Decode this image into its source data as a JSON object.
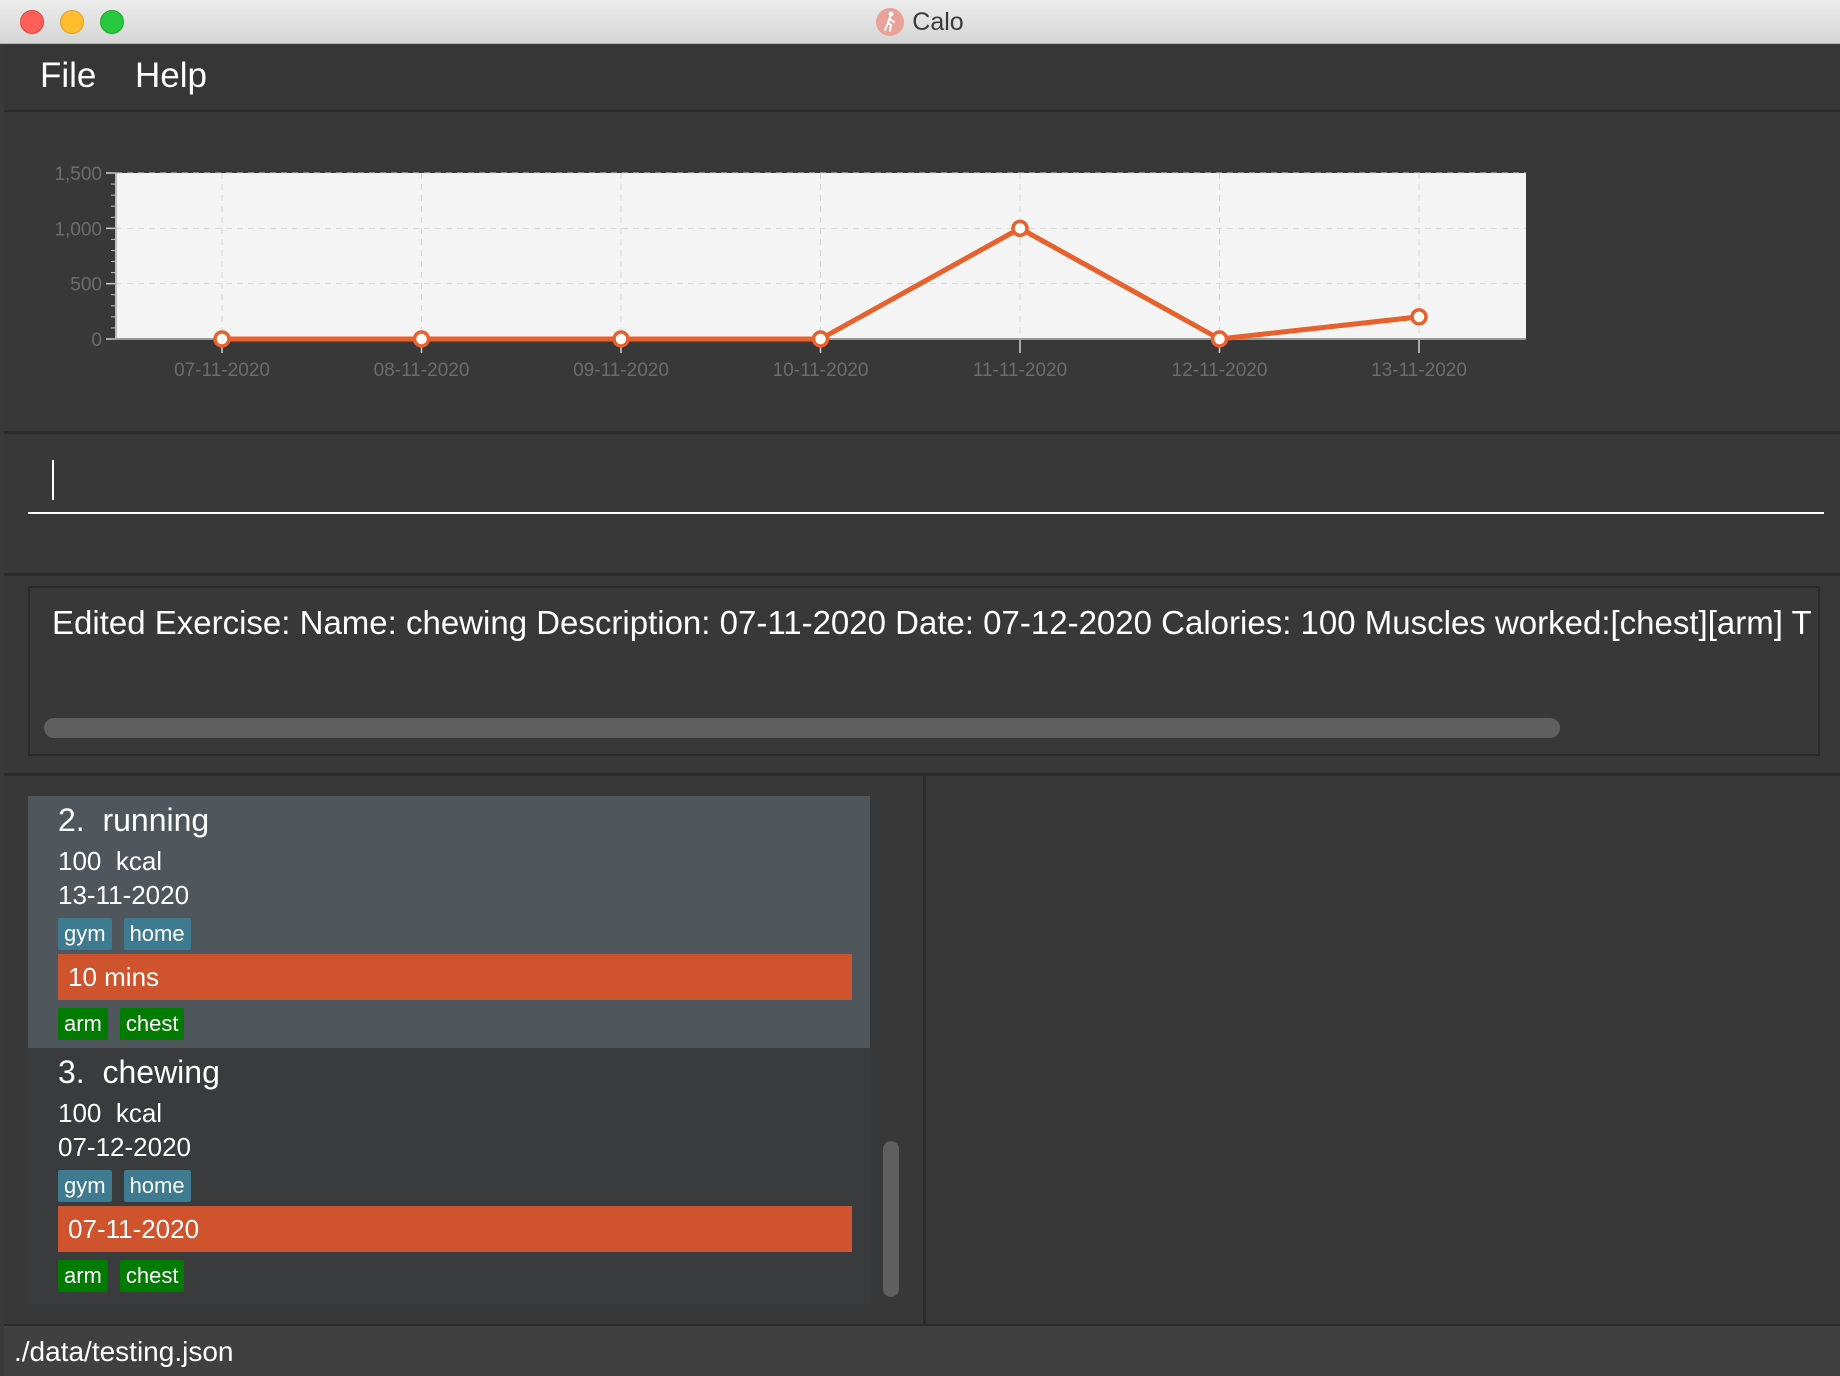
{
  "window": {
    "title": "Calo",
    "buttons": [
      "close",
      "minimize",
      "maximize"
    ],
    "app_icon": "walking-figure-icon"
  },
  "menu": {
    "items": [
      "File",
      "Help"
    ]
  },
  "chart_data": {
    "type": "line",
    "categories": [
      "07-11-2020",
      "08-11-2020",
      "09-11-2020",
      "10-11-2020",
      "11-11-2020",
      "12-11-2020",
      "13-11-2020"
    ],
    "values": [
      0,
      0,
      0,
      0,
      1000,
      0,
      200
    ],
    "ylim": [
      0,
      1500
    ],
    "yticks": [
      "0",
      "500",
      "1,000",
      "1,500"
    ],
    "grid": true,
    "line_color": "#e8602c"
  },
  "command": {
    "value": ""
  },
  "result": {
    "text": "Edited Exercise: Name: chewing Description: 07-11-2020 Date: 07-12-2020 Calories: 100 Muscles worked:[chest][arm] T"
  },
  "exercises": [
    {
      "index": "2.",
      "name": "running",
      "calories": "100",
      "unit": "kcal",
      "date": "13-11-2020",
      "tags": [
        "gym",
        "home"
      ],
      "description": "10 mins",
      "muscles": [
        "arm",
        "chest"
      ],
      "selected": true
    },
    {
      "index": "3.",
      "name": "chewing",
      "calories": "100",
      "unit": "kcal",
      "date": "07-12-2020",
      "tags": [
        "gym",
        "home"
      ],
      "description": "07-11-2020",
      "muscles": [
        "arm",
        "chest"
      ],
      "selected": false
    }
  ],
  "status": {
    "path": "./data/testing.json"
  },
  "colors": {
    "accent": "#cf532d",
    "tag": "#3e7b91",
    "muscle": "#007b00",
    "selected_card": "#50575c"
  }
}
